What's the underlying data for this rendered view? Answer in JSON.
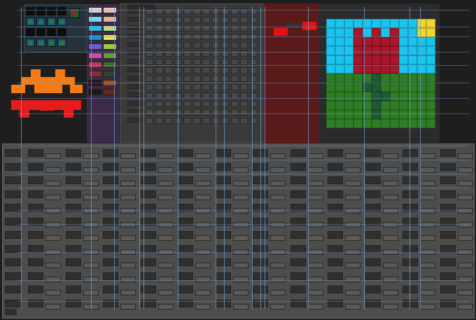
{
  "canvas": {
    "background": "#1e1e1e",
    "accent_wire": "#6f9ecf",
    "node_fill": "#474747",
    "node_dark": "#2f2f2f"
  },
  "frames": {
    "thumbnail_panel": {
      "fill": "#26323c"
    },
    "color_column": {
      "fill": "#3b2a48"
    },
    "logic_grid": {
      "fill": "#3a3a3a"
    },
    "red_zone": {
      "fill": "#5a1a1a"
    },
    "flower_art": {
      "sky": "#19c5ee",
      "stem": "#1f5a35",
      "grass": "#2f7e25",
      "petal": "#a8172a",
      "sun": "#f4d62b"
    },
    "bottom_board": {
      "fill": "#4d4d4d"
    }
  },
  "invader": {
    "orange": "#f47b15",
    "red": "#e61c1c"
  },
  "swatch_colors": [
    "#d9d9d9",
    "#79d7ef",
    "#35b7df",
    "#1b8fc4",
    "#6f5bd2",
    "#cc4bb9",
    "#b53a5e",
    "#8a2c37",
    "#25121a",
    "#1a1a1a",
    "#f5c6b0",
    "#e8b09a",
    "#c2d78c",
    "#e6e24d",
    "#9acb3a",
    "#6a9a3a",
    "#3e6b2b",
    "#2d4a26",
    "#a05020",
    "#6b2a18"
  ]
}
